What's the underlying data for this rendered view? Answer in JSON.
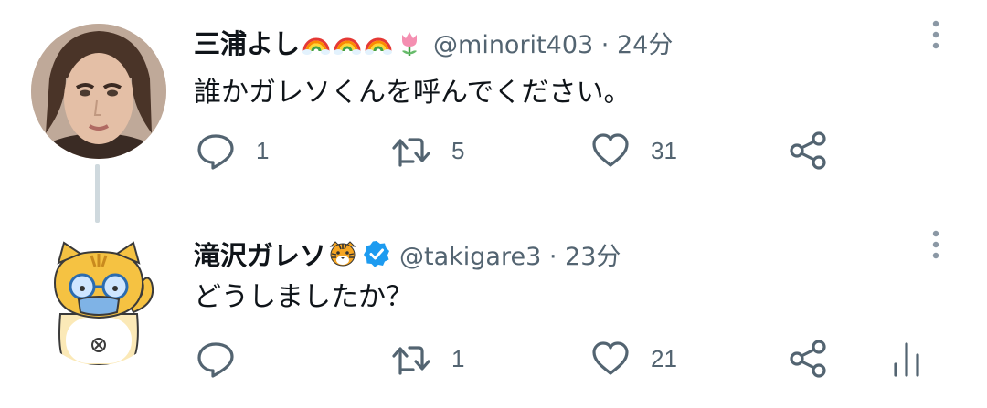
{
  "tweets": [
    {
      "display_name": "三浦よし",
      "name_emojis": [
        "rainbow-icon",
        "rainbow-icon",
        "rainbow-icon",
        "tulip-icon"
      ],
      "handle": "@minorit403",
      "separator": "·",
      "time": "24分",
      "text": "誰かガレソくんを呼んでください。",
      "reply_count": "1",
      "retweet_count": "5",
      "like_count": "31"
    },
    {
      "display_name": "滝沢ガレソ",
      "name_emojis": [
        "tiger-face-icon",
        "verified-badge-icon"
      ],
      "handle": "@takigare3",
      "separator": "·",
      "time": "23分",
      "text": "どうしましたか？",
      "reply_count": "",
      "retweet_count": "1",
      "like_count": "21"
    }
  ],
  "colors": {
    "text": "#0f1419",
    "secondary": "#536471",
    "icon": "#536471",
    "verified": "#1d9bf0",
    "thread_line": "#cfd9de"
  }
}
